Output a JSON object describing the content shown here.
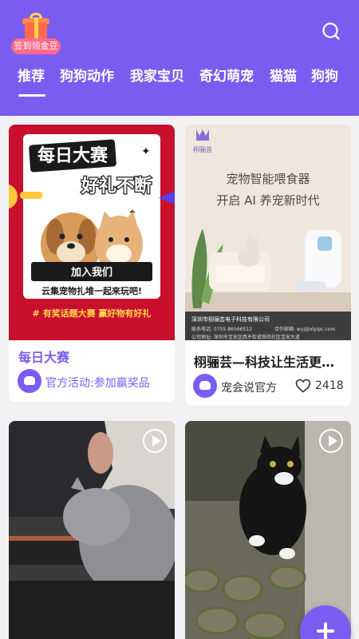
{
  "signin": {
    "label": "签到领金豆"
  },
  "tabs": [
    {
      "label": "推荐",
      "selected": true
    },
    {
      "label": "狗狗动作"
    },
    {
      "label": "我家宝贝"
    },
    {
      "label": "奇幻萌宠"
    },
    {
      "label": "猫猫"
    },
    {
      "label": "狗狗"
    }
  ],
  "cards": [
    {
      "poster": {
        "headline1": "每日大赛",
        "headline2": "好礼不断",
        "join": "加入我们",
        "slogan": "云集宠物扎堆一起来玩吧!",
        "hashtag": "# 有奖话题大赛  赢好物有好礼"
      },
      "title": "每日大赛",
      "meta": "官方活动:参加赢奖品"
    },
    {
      "poster": {
        "brand": "栩骊芸",
        "line1": "宠物智能喂食器",
        "line2": "开启 AI 养宠新时代",
        "company": "深圳市栩骊芸电子科技有限公司",
        "phone": "联系电话: 0755-86566512",
        "email": "合作邮箱: wyj@xlyipc.com",
        "address": "公司地址: 深圳市宝安区西乡街道铁岗社区宝安大道"
      },
      "title": "栩骊芸—科技让生活更美好",
      "author": "宠会说官方",
      "likes": "2418"
    },
    {
      "video": true
    },
    {
      "video": true
    }
  ],
  "colors": {
    "accent": "#7b5cf0",
    "poster_red": "#c8102e"
  }
}
